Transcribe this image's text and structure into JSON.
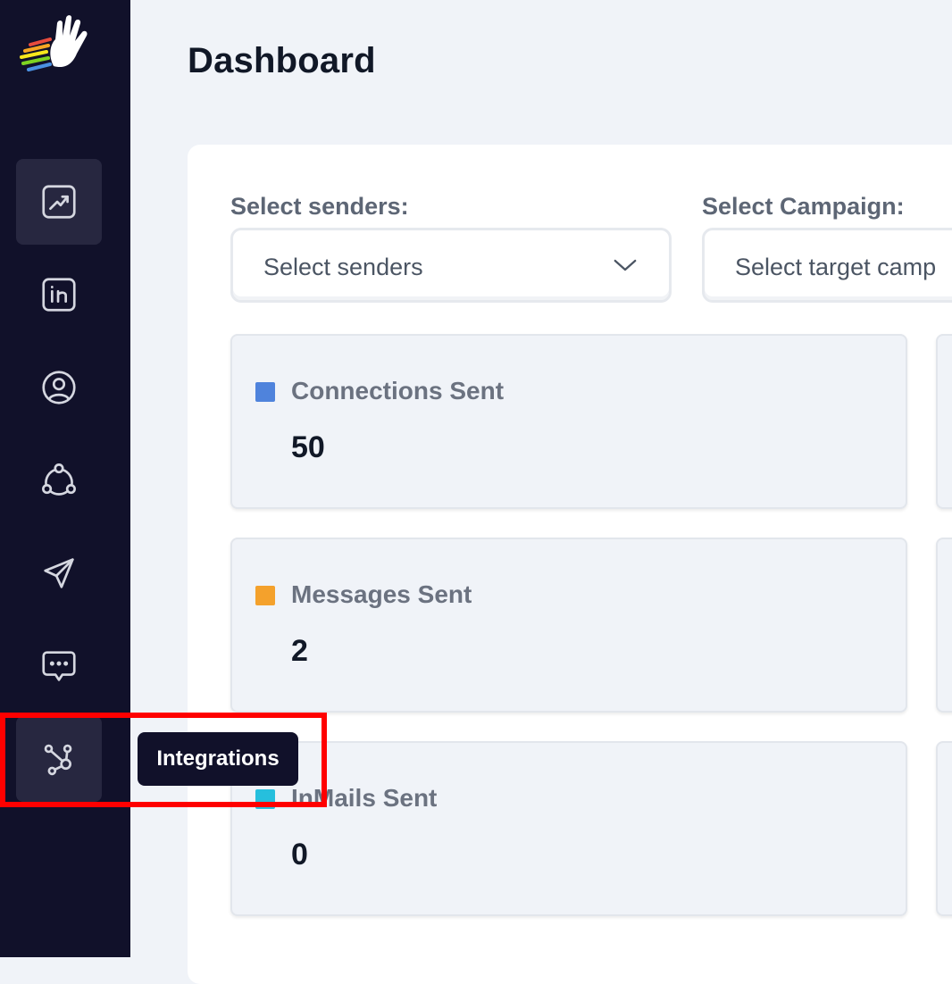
{
  "page": {
    "title": "Dashboard"
  },
  "sidebar": {
    "items": [
      {
        "name": "analytics",
        "icon": "trend-chart-icon",
        "active": true
      },
      {
        "name": "linkedin",
        "icon": "linkedin-icon",
        "active": false
      },
      {
        "name": "profile",
        "icon": "user-circle-icon",
        "active": false
      },
      {
        "name": "network",
        "icon": "network-cycle-icon",
        "active": false
      },
      {
        "name": "campaigns",
        "icon": "paper-plane-icon",
        "active": false
      },
      {
        "name": "messages",
        "icon": "chat-bubble-icon",
        "active": false
      },
      {
        "name": "integrations",
        "icon": "integrations-hub-icon",
        "active": true
      }
    ]
  },
  "tooltip": {
    "label": "Integrations"
  },
  "filters": {
    "senders": {
      "label": "Select senders:",
      "placeholder": "Select senders"
    },
    "campaign": {
      "label": "Select Campaign:",
      "placeholder": "Select target camp"
    }
  },
  "stats": [
    {
      "label": "Connections Sent",
      "value": "50",
      "color": "#4f83dc"
    },
    {
      "label": "Messages Sent",
      "value": "2",
      "color": "#f4a12c"
    },
    {
      "label": "InMails Sent",
      "value": "0",
      "color": "#26bfdd"
    }
  ],
  "colors": {
    "sidebar": "#11112a",
    "highlight": "#ff0000",
    "background": "#f0f3f8"
  }
}
